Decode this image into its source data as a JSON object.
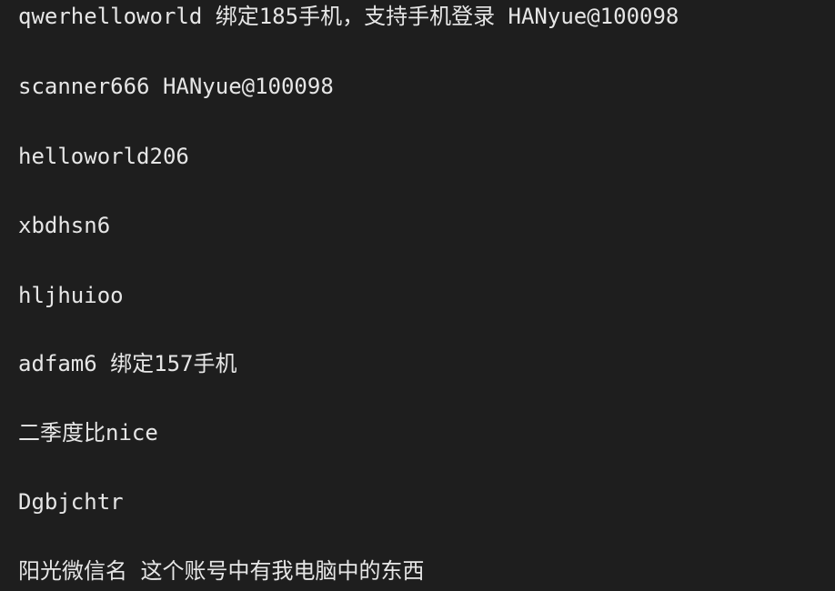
{
  "lines": [
    "qwerhelloworld 绑定185手机，支持手机登录 HANyue@100098",
    "scanner666 HANyue@100098",
    "helloworld206",
    "xbdhsn6",
    "hljhuioo",
    "adfam6 绑定157手机",
    "二季度比nice",
    "Dgbjchtr",
    "阳光微信名 这个账号中有我电脑中的东西"
  ]
}
